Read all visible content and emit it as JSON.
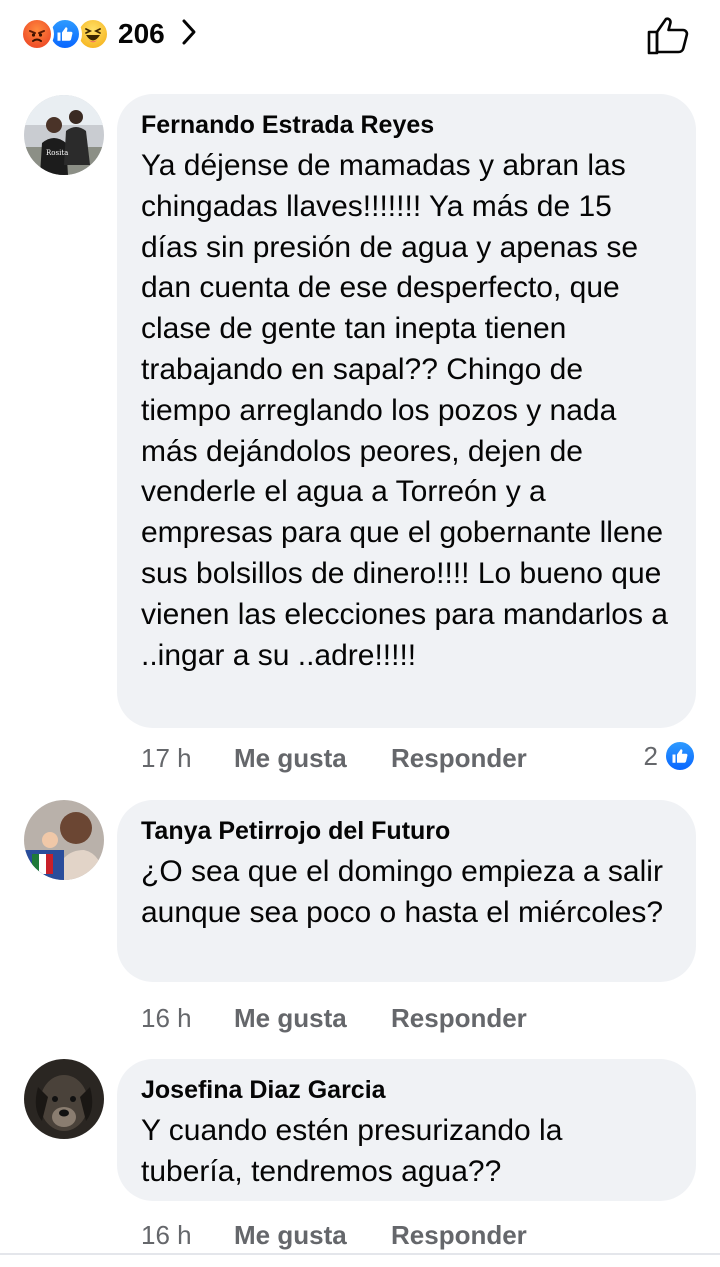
{
  "reactions": {
    "types": [
      "angry-icon",
      "like-icon",
      "haha-icon"
    ],
    "count": "206"
  },
  "comments": [
    {
      "author": "Fernando Estrada Reyes",
      "text": "Ya déjense de mamadas y abran las chingadas llaves!!!!!!! Ya más de 15 días sin presión de agua y apenas se dan cuenta de ese desperfecto, que clase de gente tan inepta tienen trabajando en sapal?? Chingo de tiempo arreglando los pozos y nada más dejándolos peores, dejen de venderle el agua a Torreón y a empresas para que el gobernante llene sus bolsillos de dinero!!!! Lo bueno que vienen las elecciones para mandarlos a ..ingar a su ..adre!!!!!",
      "time": "17 h",
      "like_label": "Me gusta",
      "reply_label": "Responder",
      "reaction_count": "2"
    },
    {
      "author": "Tanya Petirrojo del Futuro",
      "text": "¿O sea que el domingo empieza a salir aunque sea poco o hasta el miércoles?",
      "time": "16 h",
      "like_label": "Me gusta",
      "reply_label": "Responder"
    },
    {
      "author": "Josefina Diaz Garcia",
      "text": "Y cuando estén presurizando la tubería, tendremos agua??",
      "time": "16 h",
      "like_label": "Me gusta",
      "reply_label": "Responder"
    }
  ],
  "colors": {
    "bubble_bg": "#f0f2f5",
    "meta_text": "#65676b",
    "like_blue": "#0866ff"
  }
}
